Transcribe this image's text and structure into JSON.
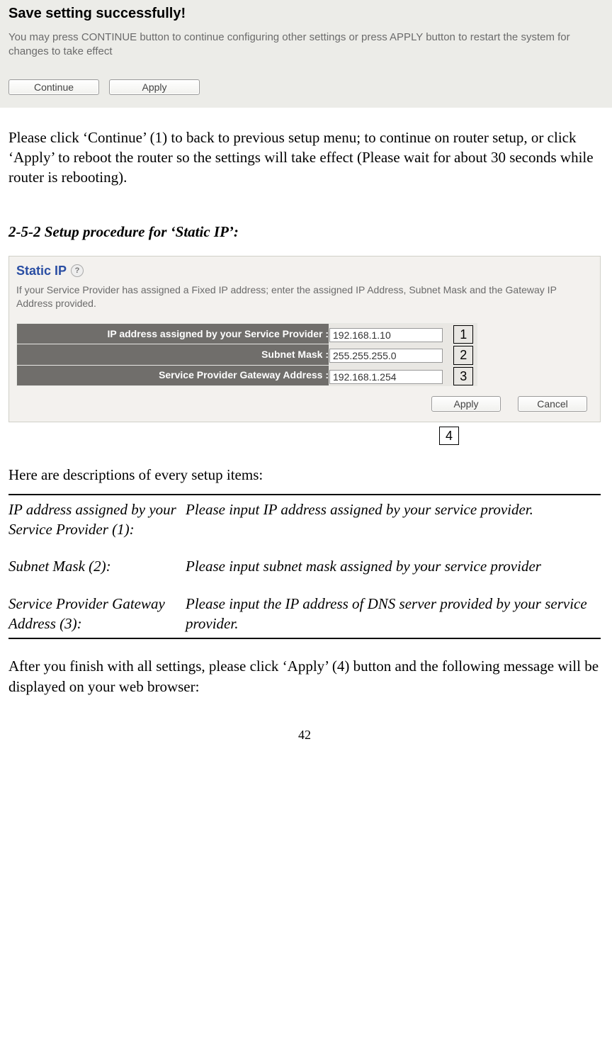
{
  "dialog": {
    "title": "Save setting successfully!",
    "body": "You may press CONTINUE button to continue configuring other settings or press APPLY button to restart the system for changes to take effect",
    "continue_label": "Continue",
    "apply_label": "Apply"
  },
  "paragraph1": "Please click ‘Continue’ (1) to back to previous setup menu; to continue on router setup, or click ‘Apply’ to reboot the router so the settings will take effect (Please wait for about 30 seconds while router is rebooting).",
  "section_heading": "2-5-2 Setup procedure for ‘Static IP’:",
  "panel": {
    "title": "Static IP",
    "desc": "If your Service Provider has assigned a Fixed IP address; enter the assigned IP Address, Subnet Mask and the Gateway IP Address provided.",
    "rows": {
      "0": {
        "label": "IP address assigned by your Service Provider :",
        "value": "192.168.1.10",
        "badge": "1"
      },
      "1": {
        "label": "Subnet Mask :",
        "value": "255.255.255.0",
        "badge": "2"
      },
      "2": {
        "label": "Service Provider Gateway Address :",
        "value": "192.168.1.254",
        "badge": "3"
      }
    },
    "apply_label": "Apply",
    "cancel_label": "Cancel",
    "badge4": "4"
  },
  "desc_intro": "Here are descriptions of every setup items:",
  "descriptions": {
    "0": {
      "label": "IP address assigned by your Service Provider (1):",
      "text": "Please input IP address assigned by your service provider."
    },
    "1": {
      "label": "Subnet Mask (2):",
      "text": "Please input subnet mask assigned by your service provider"
    },
    "2": {
      "label": "Service Provider Gateway Address (3):",
      "text": "Please input the IP address of DNS server provided by your service provider."
    }
  },
  "after_text": "After you finish with all settings, please click ‘Apply’ (4) button and the following message will be displayed on your web browser:",
  "page_number": "42"
}
